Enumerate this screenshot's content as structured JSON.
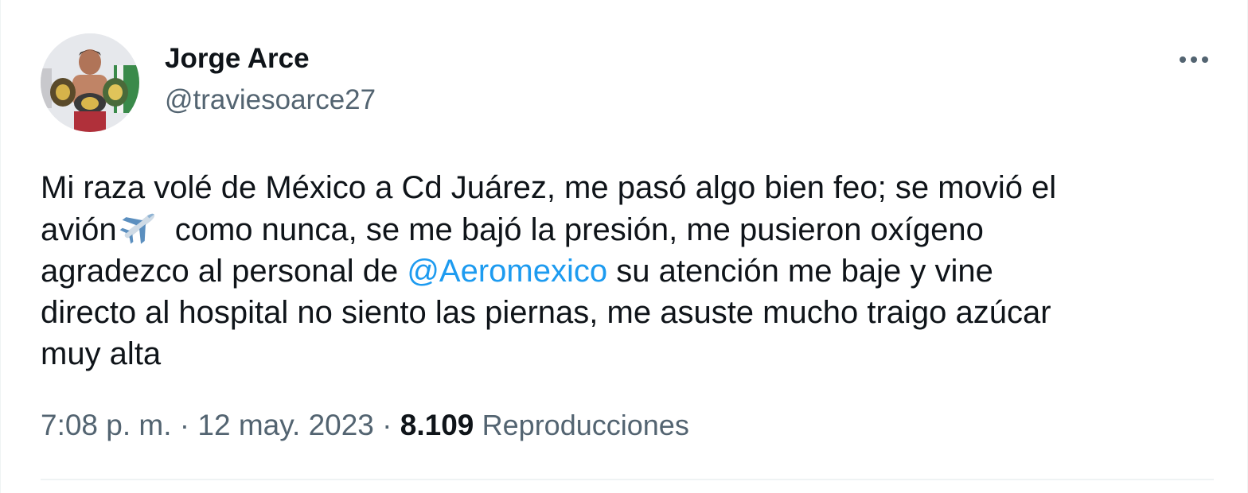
{
  "author": {
    "display_name": "Jorge Arce",
    "handle": "@traviesoarce27"
  },
  "tweet": {
    "lines": [
      "Mi raza volé de México a Cd Juárez, me pasó algo bien feo; se movió el",
      "avión",
      " como nunca, se me bajó la presión, me pusieron oxígeno",
      "agradezco al personal de ",
      "@Aeromexico",
      " su atención me baje y vine",
      "directo al hospital no siento las piernas, me asuste mucho traigo azúcar",
      "muy alta"
    ],
    "emoji_icon": "airplane-icon"
  },
  "meta": {
    "time": "7:08 p. m.",
    "separator1": " · ",
    "date": "12 may. 2023",
    "separator2": " · ",
    "views_count": "8.109",
    "views_label": "Reproducciones"
  },
  "colors": {
    "text_primary": "#0f1419",
    "text_secondary": "#536471",
    "link": "#1d9bf0",
    "divider": "#eff3f4"
  },
  "icons": {
    "more": "more-horizontal-icon"
  }
}
